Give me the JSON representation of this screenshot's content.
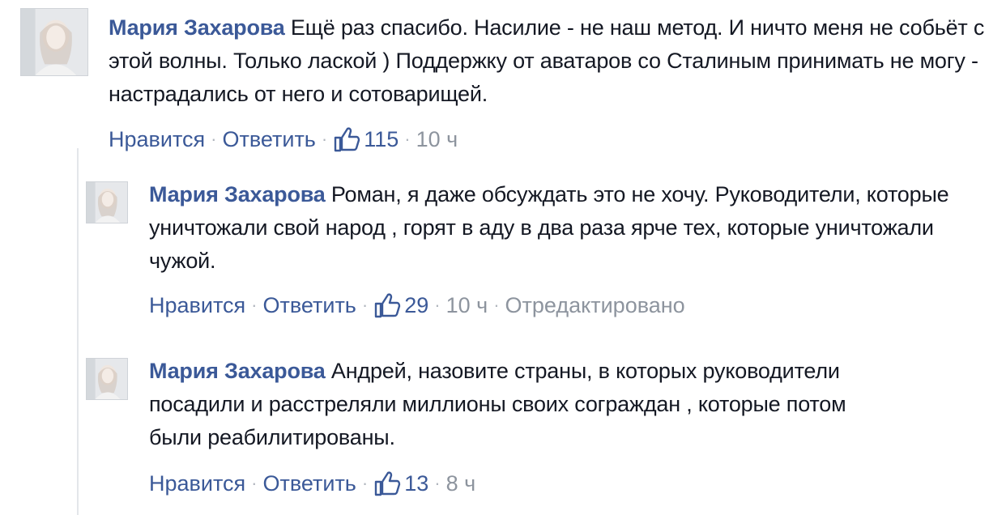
{
  "comments": [
    {
      "author": "Мария Захарова",
      "text": "Ещё раз спасибо. Насилие - не наш метод. И ничто меня не собьёт с этой волны. Только лаской ) Поддержку от аватаров со Сталиным принимать не могу - настрадались от него и сотоварищей.",
      "like_label": "Нравится",
      "reply_label": "Ответить",
      "likes": "115",
      "time": "10 ч",
      "edited": ""
    },
    {
      "author": "Мария Захарова",
      "text": "Роман, я даже обсуждать это не хочу. Руководители, которые уничтожали свой народ , горят в аду в два раза ярче тех, которые уничтожали чужой.",
      "like_label": "Нравится",
      "reply_label": "Ответить",
      "likes": "29",
      "time": "10 ч",
      "edited": "Отредактировано"
    },
    {
      "author": "Мария Захарова",
      "text": "Андрей, назовите страны, в которых руководители посадили и расстреляли миллионы своих сограждан , которые потом были реабилитированы.",
      "like_label": "Нравится",
      "reply_label": "Ответить",
      "likes": "13",
      "time": "8 ч",
      "edited": ""
    }
  ],
  "icons": {
    "like": "thumbs-up-icon",
    "avatar": "avatar-photo"
  },
  "colors": {
    "author": "#3b5998",
    "link": "#3b5998",
    "meta": "#8d949e",
    "text": "#141823"
  }
}
